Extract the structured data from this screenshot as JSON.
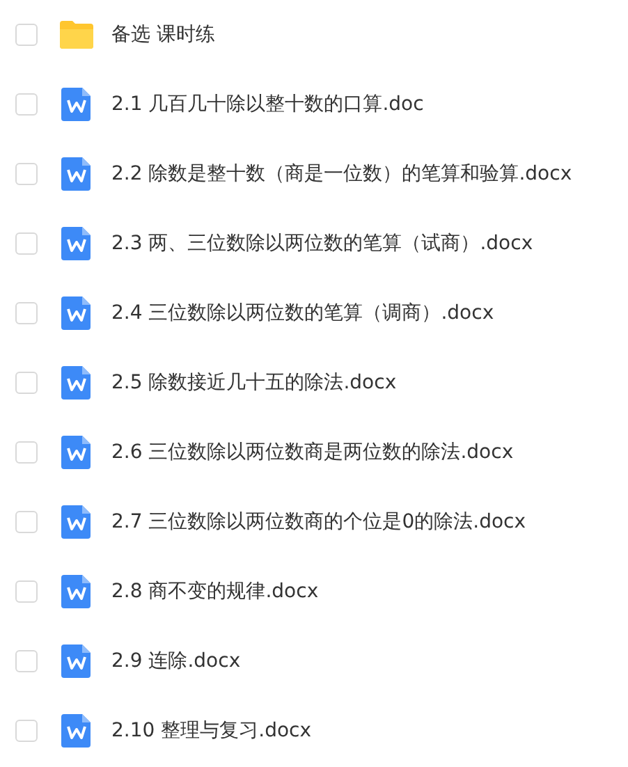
{
  "files": [
    {
      "kind": "folder",
      "name": "备选 课时练",
      "checked": false
    },
    {
      "kind": "doc",
      "name": "2.1 几百几十除以整十数的口算.doc",
      "checked": false
    },
    {
      "kind": "doc",
      "name": "2.2 除数是整十数（商是一位数）的笔算和验算.docx",
      "checked": false
    },
    {
      "kind": "doc",
      "name": "2.3 两、三位数除以两位数的笔算（试商）.docx",
      "checked": false
    },
    {
      "kind": "doc",
      "name": "2.4 三位数除以两位数的笔算（调商）.docx",
      "checked": false
    },
    {
      "kind": "doc",
      "name": "2.5 除数接近几十五的除法.docx",
      "checked": false
    },
    {
      "kind": "doc",
      "name": "2.6 三位数除以两位数商是两位数的除法.docx",
      "checked": false
    },
    {
      "kind": "doc",
      "name": "2.7 三位数除以两位数商的个位是0的除法.docx",
      "checked": false
    },
    {
      "kind": "doc",
      "name": "2.8 商不变的规律.docx",
      "checked": false
    },
    {
      "kind": "doc",
      "name": "2.9 连除.docx",
      "checked": false
    },
    {
      "kind": "doc",
      "name": "2.10 整理与复习.docx",
      "checked": false
    }
  ]
}
